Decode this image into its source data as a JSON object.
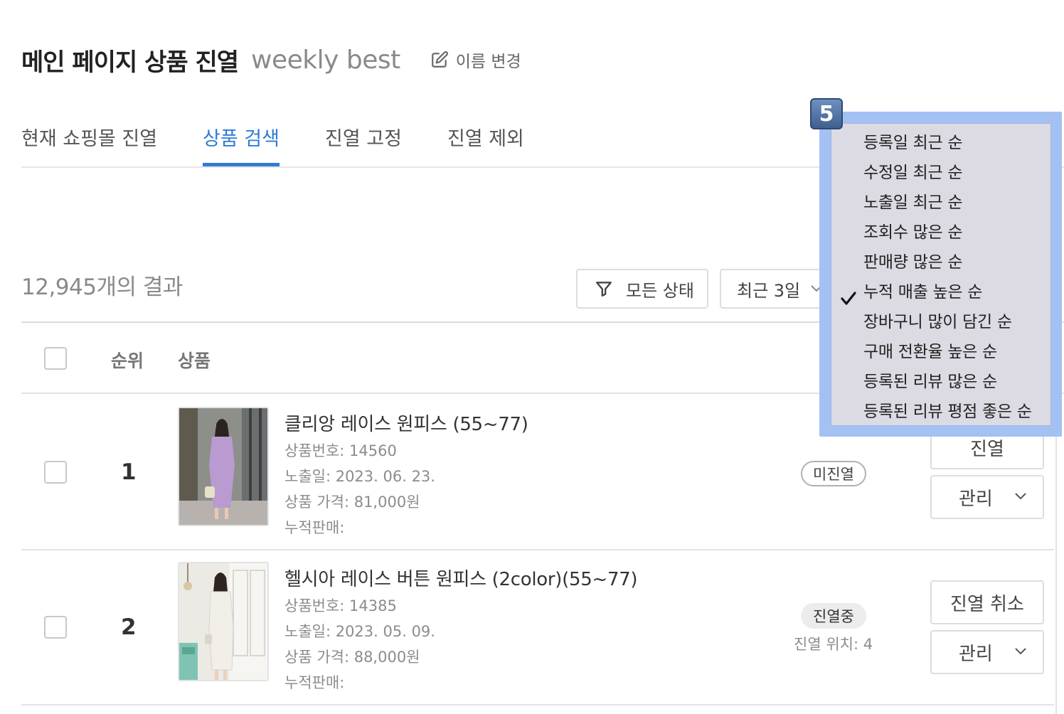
{
  "header": {
    "title": "메인 페이지 상품 진열",
    "subtitle": "weekly best",
    "rename_label": "이름 변경"
  },
  "tabs": [
    {
      "label": "현재 쇼핑몰 진열",
      "active": false
    },
    {
      "label": "상품 검색",
      "active": true
    },
    {
      "label": "진열 고정",
      "active": false
    },
    {
      "label": "진열 제외",
      "active": false
    }
  ],
  "results": {
    "count_text": "12,945개의 결과",
    "filter_label": "모든 상태",
    "period_label": "최근 3일"
  },
  "table": {
    "headers": {
      "rank": "순위",
      "product": "상품"
    },
    "rows": [
      {
        "rank": "1",
        "name": "클리앙 레이스 원피스 (55~77)",
        "product_no": "상품번호: 14560",
        "exposed_date": "노출일: 2023. 06. 23.",
        "price": "상품 가격: 81,000원",
        "cumulative_sales": "누적판매:",
        "status": "미진열",
        "action_label": "진열",
        "manage_label": "관리"
      },
      {
        "rank": "2",
        "name": "헬시아 레이스 버튼 원피스 (2color)(55~77)",
        "product_no": "상품번호: 14385",
        "exposed_date": "노출일: 2023. 05. 09.",
        "price": "상품 가격: 88,000원",
        "cumulative_sales": "누적판매:",
        "status": "진열중",
        "status_sub": "진열 위치: 4",
        "action_label": "진열 취소",
        "manage_label": "관리"
      }
    ]
  },
  "sort_dropdown": {
    "badge": "5",
    "selected_index": 5,
    "options": [
      "등록일 최근 순",
      "수정일 최근 순",
      "노출일 최근 순",
      "조회수 많은 순",
      "판매량 많은 순",
      "누적 매출 높은 순",
      "장바구니 많이 담긴 순",
      "구매 전환율 높은 순",
      "등록된 리뷰 많은 순",
      "등록된 리뷰 평점 좋은 순"
    ]
  },
  "colors": {
    "accent": "#2f7cd4",
    "dropdown_highlight": "#a4c1f4",
    "dropdown_bg": "#dcdbe3"
  }
}
